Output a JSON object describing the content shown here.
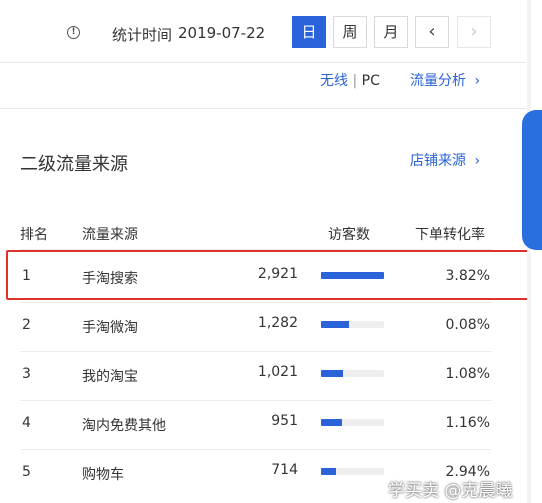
{
  "toolbar": {
    "stat_label": "统计时间",
    "stat_date": "2019-07-22",
    "periods": [
      "日",
      "周",
      "月"
    ],
    "active_period": "日",
    "prev_label": "‹",
    "next_label": "›"
  },
  "links": {
    "wireless": "无线",
    "divider": "|",
    "pc": "PC",
    "traffic_analysis": "流量分析",
    "chevron": "›"
  },
  "section": {
    "title": "二级流量来源",
    "shop_source_link": "店铺来源",
    "chevron": "›"
  },
  "table": {
    "headers": {
      "rank": "排名",
      "source": "流量来源",
      "visitors": "访客数",
      "conversion": "下单转化率"
    },
    "rows": [
      {
        "rank": "1",
        "source": "手淘搜索",
        "visitors": "2,921",
        "visitors_value": 2921,
        "conversion": "3.82%"
      },
      {
        "rank": "2",
        "source": "手淘微淘",
        "visitors": "1,282",
        "visitors_value": 1282,
        "conversion": "0.08%"
      },
      {
        "rank": "3",
        "source": "我的淘宝",
        "visitors": "1,021",
        "visitors_value": 1021,
        "conversion": "1.08%"
      },
      {
        "rank": "4",
        "source": "淘内免费其他",
        "visitors": "951",
        "visitors_value": 951,
        "conversion": "1.16%"
      },
      {
        "rank": "5",
        "source": "购物车",
        "visitors": "714",
        "visitors_value": 714,
        "conversion": "2.94%"
      }
    ],
    "bar_max": 2921
  },
  "watermark": "学买卖 @克晨曦",
  "colors": {
    "accent": "#2962d9",
    "highlight": "#e0302a"
  }
}
